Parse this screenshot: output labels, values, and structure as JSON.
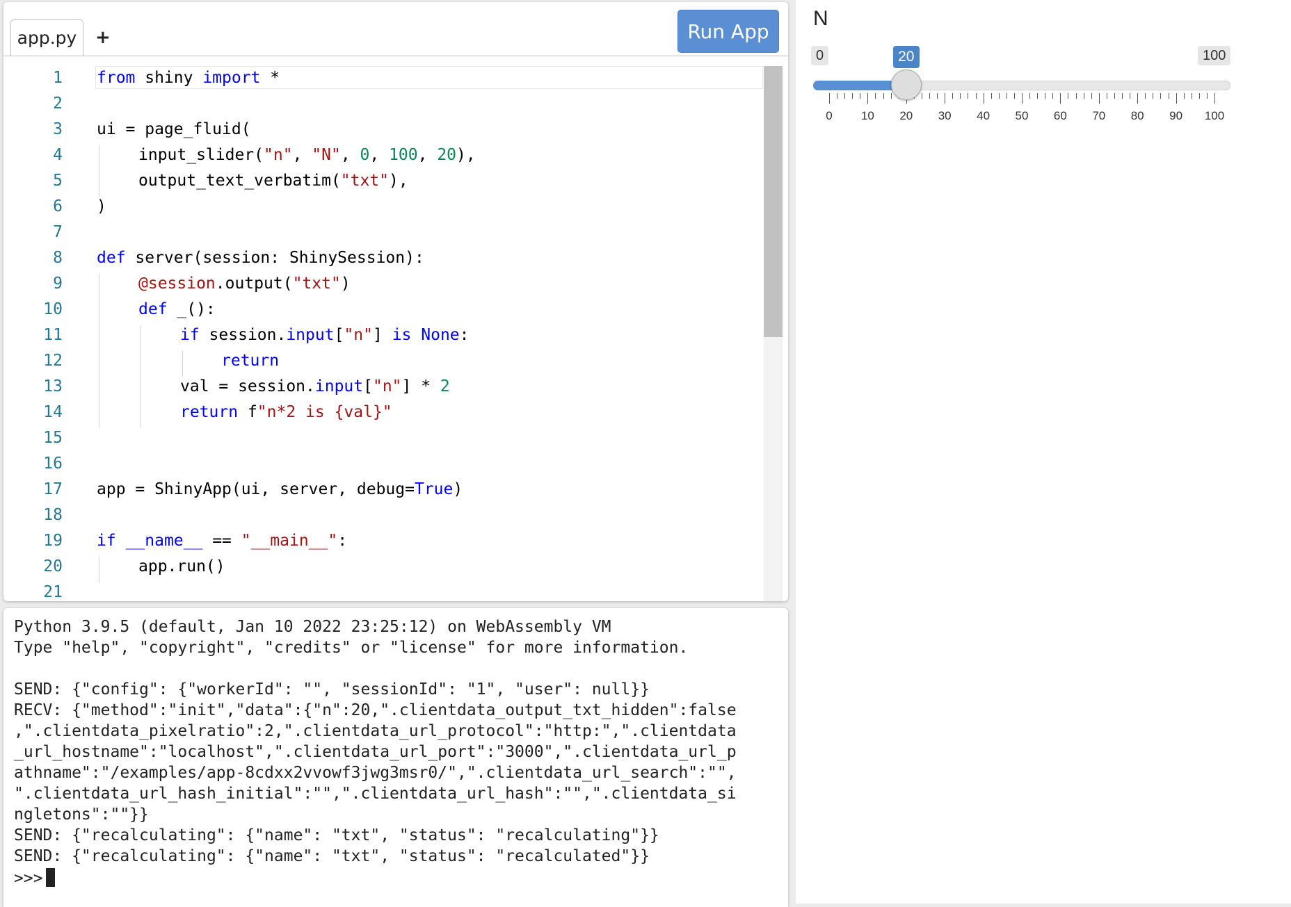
{
  "editor": {
    "tab_label": "app.py",
    "add_tab_label": "+",
    "run_button_label": "Run App",
    "lines": [
      {
        "n": "1"
      },
      {
        "n": "2"
      },
      {
        "n": "3"
      },
      {
        "n": "4"
      },
      {
        "n": "5"
      },
      {
        "n": "6"
      },
      {
        "n": "7"
      },
      {
        "n": "8"
      },
      {
        "n": "9"
      },
      {
        "n": "10"
      },
      {
        "n": "11"
      },
      {
        "n": "12"
      },
      {
        "n": "13"
      },
      {
        "n": "14"
      },
      {
        "n": "15"
      },
      {
        "n": "16"
      },
      {
        "n": "17"
      },
      {
        "n": "18"
      },
      {
        "n": "19"
      },
      {
        "n": "20"
      },
      {
        "n": "21"
      }
    ],
    "code": {
      "l1_kw1": "from",
      "l1_txt1": " shiny ",
      "l1_kw2": "import",
      "l1_txt2": " *",
      "l3": "ui = page_fluid(",
      "l4_a": "input_slider(",
      "l4_s1": "\"n\"",
      "l4_b": ", ",
      "l4_s2": "\"N\"",
      "l4_c": ", ",
      "l4_n1": "0",
      "l4_d": ", ",
      "l4_n2": "100",
      "l4_e": ", ",
      "l4_n3": "20",
      "l4_f": "),",
      "l5_a": "output_text_verbatim(",
      "l5_s": "\"txt\"",
      "l5_b": "),",
      "l6": ")",
      "l8_kw": "def",
      "l8_txt": " server(session: ShinySession):",
      "l9_dec": "@session",
      "l9_a": ".output(",
      "l9_s": "\"txt\"",
      "l9_b": ")",
      "l10_kw": "def",
      "l10_txt": " _():",
      "l11_kw1": "if",
      "l11_a": " session.",
      "l11_kw2": "input",
      "l11_b": "[",
      "l11_s": "\"n\"",
      "l11_c": "] ",
      "l11_kw3": "is",
      "l11_d": " ",
      "l11_kw4": "None",
      "l11_e": ":",
      "l12_kw": "return",
      "l13_a": "val = session.",
      "l13_kw": "input",
      "l13_b": "[",
      "l13_s": "\"n\"",
      "l13_c": "] * ",
      "l13_n": "2",
      "l14_kw": "return",
      "l14_a": " f",
      "l14_s": "\"n*2 is {val}\"",
      "l17_a": "app = ShinyApp(ui, server, debug=",
      "l17_kw": "True",
      "l17_b": ")",
      "l19_kw": "if",
      "l19_a": " ",
      "l19_b": "__name__",
      "l19_c": " == ",
      "l19_s": "\"__main__\"",
      "l19_d": ":",
      "l20": "app.run()"
    }
  },
  "console": {
    "lines": [
      "Python 3.9.5 (default, Jan 10 2022 23:25:12) on WebAssembly VM",
      "Type \"help\", \"copyright\", \"credits\" or \"license\" for more information.",
      "",
      "SEND: {\"config\": {\"workerId\": \"\", \"sessionId\": \"1\", \"user\": null}}",
      "RECV: {\"method\":\"init\",\"data\":{\"n\":20,\".clientdata_output_txt_hidden\":false",
      ",\".clientdata_pixelratio\":2,\".clientdata_url_protocol\":\"http:\",\".clientdata",
      "_url_hostname\":\"localhost\",\".clientdata_url_port\":\"3000\",\".clientdata_url_p",
      "athname\":\"/examples/app-8cdxx2vvowf3jwg3msr0/\",\".clientdata_url_search\":\"\",",
      "\".clientdata_url_hash_initial\":\"\",\".clientdata_url_hash\":\"\",\".clientdata_si",
      "ngletons\":\"\"}}",
      "SEND: {\"recalculating\": {\"name\": \"txt\", \"status\": \"recalculating\"}}",
      "SEND: {\"recalculating\": {\"name\": \"txt\", \"status\": \"recalculated\"}}"
    ],
    "prompt": ">>>"
  },
  "app": {
    "slider": {
      "label": "N",
      "min": 0,
      "max": 100,
      "value": 20,
      "min_label": "0",
      "max_label": "100",
      "value_label": "20",
      "tick_labels": [
        "0",
        "10",
        "20",
        "30",
        "40",
        "50",
        "60",
        "70",
        "80",
        "90",
        "100"
      ]
    }
  },
  "colors": {
    "accent": "#5b8fd3",
    "keyword": "#0000ff",
    "string": "#a31515",
    "number": "#098658",
    "line_number": "#237893"
  }
}
